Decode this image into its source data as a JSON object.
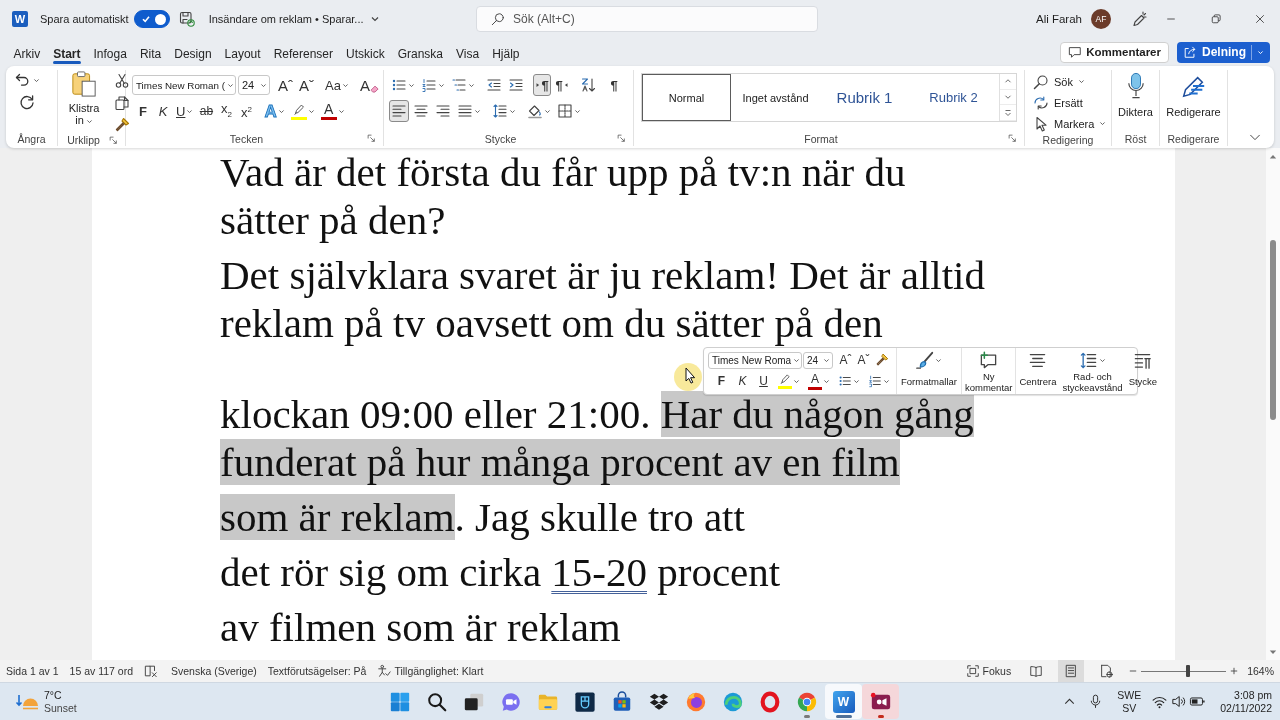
{
  "title_bar": {
    "logo_glyph": "W",
    "autosave": {
      "label": "Spara automatiskt",
      "on": true
    },
    "document_title": "Insändare om reklam • Sparar...",
    "search": {
      "placeholder": "Sök (Alt+C)"
    },
    "user": {
      "name": "Ali Farah",
      "initials": "AF"
    }
  },
  "menu_tabs": [
    {
      "label": "Arkiv",
      "selected": false
    },
    {
      "label": "Start",
      "selected": true
    },
    {
      "label": "Infoga",
      "selected": false
    },
    {
      "label": "Rita",
      "selected": false
    },
    {
      "label": "Design",
      "selected": false
    },
    {
      "label": "Layout",
      "selected": false
    },
    {
      "label": "Referenser",
      "selected": false
    },
    {
      "label": "Utskick",
      "selected": false
    },
    {
      "label": "Granska",
      "selected": false
    },
    {
      "label": "Visa",
      "selected": false
    },
    {
      "label": "Hjälp",
      "selected": false
    }
  ],
  "comments_button": "Kommentarer",
  "share_button": "Delning",
  "ribbon": {
    "undo_group": {
      "label": "Ångra"
    },
    "clipboard_group": {
      "label": "Urklipp",
      "paste_label": "Klistra in"
    },
    "font_group": {
      "label": "Tecken",
      "font_name": "Times New Roman (",
      "font_size": "24",
      "row_1": [
        {
          "kind": "grow",
          "glyph": "Aˆ",
          "dropdown": false
        },
        {
          "kind": "shrink",
          "glyph": "Aˇ",
          "dropdown": false
        },
        {
          "kind": "case",
          "glyph": "Aa",
          "dropdown": true
        },
        {
          "kind": "clear",
          "glyph": "A",
          "dropdown": false
        }
      ],
      "row_2": [
        {
          "kind": "bold",
          "glyph": "F",
          "dropdown": false
        },
        {
          "kind": "italic",
          "glyph": "K",
          "dropdown": false
        },
        {
          "kind": "underline",
          "glyph": "U",
          "dropdown": true
        },
        {
          "kind": "strike",
          "glyph": "ab",
          "dropdown": false
        },
        {
          "kind": "subscript",
          "glyph": "x$_{2}$",
          "dropdown": false
        },
        {
          "kind": "superscript",
          "glyph": "x$^{2}$",
          "dropdown": false
        },
        {
          "kind": "effects",
          "glyph": "A",
          "dropdown": true
        },
        {
          "kind": "highlight",
          "color": "#ffff00",
          "dropdown": true
        },
        {
          "kind": "font_color",
          "glyph": "A",
          "color": "#c00000",
          "dropdown": true
        }
      ]
    },
    "paragraph_group": {
      "label": "Stycke",
      "row_1": [
        {
          "kind": "bullets",
          "dropdown": true,
          "pressed": false
        },
        {
          "kind": "numbering",
          "dropdown": true,
          "pressed": false
        },
        {
          "kind": "multilevel",
          "dropdown": true,
          "pressed": false
        },
        {
          "kind": "outdent",
          "dropdown": false,
          "pressed": false
        },
        {
          "kind": "indent",
          "dropdown": false,
          "pressed": false
        },
        {
          "kind": "ltr",
          "glyph": "¶",
          "dropdown": false,
          "pressed": true
        },
        {
          "kind": "rtl",
          "glyph": "¶",
          "dropdown": false,
          "pressed": false
        },
        {
          "kind": "sort",
          "dropdown": false,
          "pressed": false
        },
        {
          "kind": "marks",
          "glyph": "¶",
          "dropdown": false,
          "pressed": false
        }
      ],
      "row_2": [
        {
          "kind": "align_left",
          "dropdown": false,
          "pressed": true
        },
        {
          "kind": "align_center",
          "dropdown": false,
          "pressed": false
        },
        {
          "kind": "align_right",
          "dropdown": false,
          "pressed": false
        },
        {
          "kind": "justify",
          "dropdown": true,
          "pressed": false
        },
        {
          "kind": "line_spacing",
          "dropdown": true,
          "pressed": false
        },
        {
          "kind": "shading",
          "dropdown": true,
          "pressed": false
        },
        {
          "kind": "borders",
          "dropdown": true,
          "pressed": false
        }
      ]
    },
    "styles_group": {
      "label": "Format",
      "styles": [
        {
          "name": "Normal",
          "selected": true
        },
        {
          "name": "Inget avstånd",
          "selected": false
        },
        {
          "name": "Rubrik 1",
          "selected": false
        },
        {
          "name": "Rubrik 2",
          "selected": false
        }
      ]
    },
    "editing_group": {
      "label": "Redigering",
      "items": [
        {
          "kind": "find",
          "label": "Sök",
          "dropdown": true
        },
        {
          "kind": "replace",
          "label": "Ersätt",
          "dropdown": false
        },
        {
          "kind": "select",
          "label": "Markera",
          "dropdown": true
        }
      ]
    },
    "voice_group": {
      "label": "Röst",
      "button": "Diktera"
    },
    "editor_group": {
      "label": "Redigerare",
      "button": "Redigerare"
    }
  },
  "document": {
    "paragraphs": [
      {
        "lines": [
          {
            "segments": [
              {
                "text": "Vad är det första du får upp på tv:n när du",
                "selected": false,
                "flagged": false
              }
            ]
          },
          {
            "segments": [
              {
                "text": "sätter på den?",
                "selected": false,
                "flagged": false
              }
            ]
          }
        ]
      },
      {
        "lines": [
          {
            "segments": [
              {
                "text": "Det självklara svaret är ju reklam! Det är alltid",
                "selected": false,
                "flagged": false
              }
            ]
          },
          {
            "segments": [
              {
                "text": "reklam på tv oavsett om du sätter på den",
                "selected": false,
                "flagged": false
              }
            ]
          }
        ]
      },
      {
        "lines": [
          {
            "segments": [
              {
                "text": "klockan 09:00 eller 21:00. ",
                "selected": false,
                "flagged": false
              },
              {
                "text": "Har du någon gång",
                "selected": true,
                "flagged": false
              }
            ]
          },
          {
            "segments": [
              {
                "text": "funderat på hur många procent av en film",
                "selected": true,
                "flagged": false
              }
            ]
          }
        ]
      },
      {
        "lines": [
          {
            "segments": [
              {
                "text": "som är reklam",
                "selected": true,
                "flagged": false
              },
              {
                "text": ". Jag skulle tro att",
                "selected": false,
                "flagged": false
              }
            ]
          }
        ]
      },
      {
        "lines": [
          {
            "segments": [
              {
                "text": "det rör sig om cirka ",
                "selected": false,
                "flagged": false
              },
              {
                "text": "15-20",
                "selected": false,
                "flagged": true
              },
              {
                "text": " procent",
                "selected": false,
                "flagged": false
              }
            ]
          }
        ]
      },
      {
        "lines": [
          {
            "segments": [
              {
                "text": "av filmen som är reklam",
                "selected": false,
                "flagged": false
              }
            ]
          }
        ]
      }
    ]
  },
  "mini_toolbar": {
    "font_name": "Times New Roma",
    "font_size": "24",
    "row_1": [
      {
        "kind": "grow",
        "glyph": "Aˆ",
        "dropdown": false
      },
      {
        "kind": "shrink",
        "glyph": "Aˇ",
        "dropdown": false
      },
      {
        "kind": "painter",
        "dropdown": false
      }
    ],
    "row_2": [
      {
        "kind": "bold",
        "glyph": "F",
        "dropdown": false
      },
      {
        "kind": "italic",
        "glyph": "K",
        "dropdown": false
      },
      {
        "kind": "underline",
        "glyph": "U",
        "dropdown": false
      },
      {
        "kind": "highlight",
        "color": "#ffff00",
        "dropdown": true
      },
      {
        "kind": "font_color",
        "glyph": "A",
        "color": "#c00000",
        "dropdown": true
      },
      {
        "kind": "bullets",
        "dropdown": true
      },
      {
        "kind": "numbering",
        "dropdown": true
      }
    ],
    "buttons": [
      {
        "kind": "styles",
        "label": "Formatmallar",
        "dropdown": true
      },
      {
        "kind": "comment",
        "label": "Ny kommentar",
        "dropdown": false
      },
      {
        "kind": "center",
        "label": "Centrera",
        "dropdown": false
      },
      {
        "kind": "spacing",
        "label": "Rad- och styckeavstånd",
        "dropdown": true
      },
      {
        "kind": "paragraph",
        "label": "Stycke",
        "dropdown": false
      }
    ]
  },
  "status_bar": {
    "page": "Sida 1 av 1",
    "words": "15 av 117 ord",
    "language": "Svenska (Sverige)",
    "predictions": "Textförutsägelser: På",
    "accessibility": "Tillgänglighet: Klart",
    "focus": "Fokus",
    "views": [
      {
        "kind": "read",
        "selected": false
      },
      {
        "kind": "print",
        "selected": true
      },
      {
        "kind": "web",
        "selected": false
      }
    ],
    "zoom": {
      "level": 0.55,
      "reading": "164%"
    }
  },
  "taskbar": {
    "weather": {
      "temperature": "7°C",
      "condition": "Sunset"
    },
    "apps": [
      {
        "kind": "start",
        "running": false,
        "active": false,
        "alert": false
      },
      {
        "kind": "search",
        "running": false,
        "active": false,
        "alert": false
      },
      {
        "kind": "task_view",
        "running": false,
        "active": false,
        "alert": false
      },
      {
        "kind": "chat",
        "running": false,
        "active": false,
        "alert": false
      },
      {
        "kind": "explorer",
        "running": false,
        "active": false,
        "alert": false
      },
      {
        "kind": "remote",
        "running": false,
        "active": false,
        "alert": false
      },
      {
        "kind": "store",
        "running": false,
        "active": false,
        "alert": false
      },
      {
        "kind": "dropbox",
        "running": false,
        "active": false,
        "alert": false
      },
      {
        "kind": "firefox",
        "running": false,
        "active": false,
        "alert": false
      },
      {
        "kind": "edge",
        "running": false,
        "active": false,
        "alert": false
      },
      {
        "kind": "opera",
        "running": false,
        "active": false,
        "alert": false
      },
      {
        "kind": "chrome",
        "running": true,
        "active": false,
        "alert": false
      },
      {
        "kind": "word",
        "glyph": "W",
        "running": true,
        "active": true,
        "alert": false
      },
      {
        "kind": "recorder",
        "running": true,
        "active": false,
        "alert": true
      }
    ],
    "language": {
      "code": "SWE",
      "layout": "SV"
    },
    "clock": {
      "time": "3:08 pm",
      "date": "02/11/2022"
    }
  }
}
